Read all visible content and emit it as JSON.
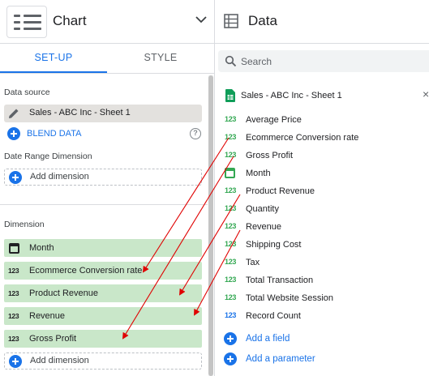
{
  "chart_panel": {
    "title": "Chart",
    "tabs": [
      {
        "label": "SET-UP",
        "active": true
      },
      {
        "label": "STYLE",
        "active": false
      }
    ],
    "data_source_label": "Data source",
    "data_source_name": "Sales - ABC Inc - Sheet 1",
    "blend_label": "BLEND DATA",
    "help_glyph": "?",
    "date_range_label": "Date Range Dimension",
    "add_dimension_label": "Add dimension",
    "dimension_label": "Dimension",
    "dimensions": [
      {
        "label": "Month",
        "icon": "calendar-icon"
      },
      {
        "label": "Ecommerce Conversion rate",
        "icon_text": "123"
      },
      {
        "label": "Product Revenue",
        "icon_text": "123"
      },
      {
        "label": "Revenue",
        "icon_text": "123"
      },
      {
        "label": "Gross Profit",
        "icon_text": "123"
      }
    ],
    "add_dimension_bottom_label": "Add dimension"
  },
  "data_panel": {
    "title": "Data",
    "search_placeholder": "Search",
    "sheet_name": "Sales - ABC Inc - Sheet 1",
    "close_glyph": "×",
    "fields": [
      {
        "label": "Average Price",
        "icon_text": "123",
        "color": "#34a853"
      },
      {
        "label": "Ecommerce Conversion rate",
        "icon_text": "123",
        "color": "#34a853"
      },
      {
        "label": "Gross Profit",
        "icon_text": "123",
        "color": "#34a853"
      },
      {
        "label": "Month",
        "icon": "calendar-icon",
        "color": "#34a853"
      },
      {
        "label": "Product Revenue",
        "icon_text": "123",
        "color": "#34a853"
      },
      {
        "label": "Quantity",
        "icon_text": "123",
        "color": "#34a853"
      },
      {
        "label": "Revenue",
        "icon_text": "123",
        "color": "#34a853"
      },
      {
        "label": "Shipping Cost",
        "icon_text": "123",
        "color": "#34a853"
      },
      {
        "label": "Tax",
        "icon_text": "123",
        "color": "#34a853"
      },
      {
        "label": "Total Transaction",
        "icon_text": "123",
        "color": "#34a853"
      },
      {
        "label": "Total Website Session",
        "icon_text": "123",
        "color": "#34a853"
      },
      {
        "label": "Record Count",
        "icon_text": "123",
        "color": "#1a73e8"
      }
    ],
    "add_field_label": "Add a field",
    "add_parameter_label": "Add a parameter"
  },
  "colors": {
    "accent": "#1a73e8",
    "dimension_fill": "#c9e7c9",
    "metric_icon": "#34a853",
    "arrow": "#e00000"
  }
}
